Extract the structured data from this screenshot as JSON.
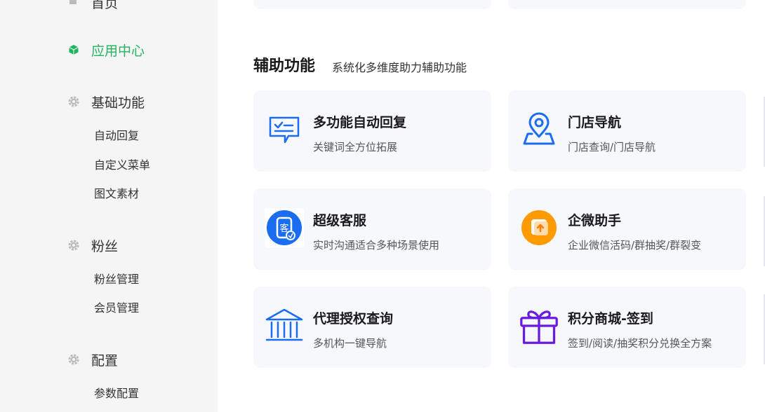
{
  "sidebar": {
    "top_item": "首页",
    "active_item": "应用中心",
    "groups": [
      {
        "label": "基础功能",
        "items": [
          "自动回复",
          "自定义菜单",
          "图文素材"
        ]
      },
      {
        "label": "粉丝",
        "items": [
          "粉丝管理",
          "会员管理"
        ]
      },
      {
        "label": "配置",
        "items": [
          "参数配置"
        ]
      }
    ]
  },
  "main": {
    "section": {
      "title": "辅助功能",
      "subtitle": "系统化多维度助力辅助功能"
    },
    "cards": [
      {
        "title": "多功能自动回复",
        "desc": "关键词全方位拓展"
      },
      {
        "title": "门店导航",
        "desc": "门店查询/门店导航"
      },
      {
        "title": "超级客服",
        "desc": "实时沟通适合多种场景使用",
        "icon_glyph": "客"
      },
      {
        "title": "企微助手",
        "desc": "企业微信活码/群抽奖/群裂变"
      },
      {
        "title": "代理授权查询",
        "desc": "多机构一键导航"
      },
      {
        "title": "积分商城-签到",
        "desc": "签到/阅读/抽奖积分兑换全方案"
      }
    ]
  },
  "colors": {
    "accent_green": "#22b35e",
    "icon_blue": "#1a6cf0",
    "orange": "#ff9a00",
    "purple": "#6a1be0"
  }
}
